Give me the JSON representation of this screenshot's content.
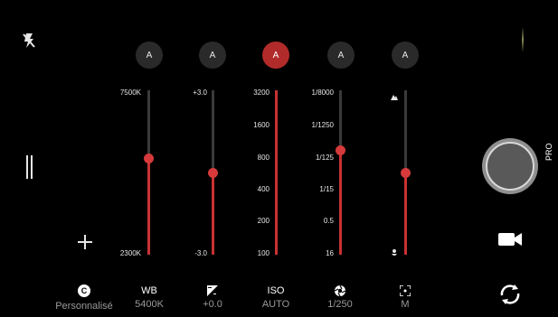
{
  "top_auto": [
    {
      "label": "A",
      "active": false
    },
    {
      "label": "A",
      "active": false
    },
    {
      "label": "A",
      "active": true
    },
    {
      "label": "A",
      "active": false
    },
    {
      "label": "A",
      "active": false
    }
  ],
  "sliders": {
    "wb": {
      "top": "7500K",
      "bottom": "2300K",
      "level": 0.59
    },
    "ev": {
      "top": "+3.0",
      "bottom": "-3.0",
      "level": 0.5
    },
    "iso": {
      "ticks": [
        "3200",
        "1600",
        "800",
        "400",
        "200",
        "100"
      ],
      "level": 1.0
    },
    "shutter": {
      "ticks": [
        "1/8000",
        "1/1250",
        "1/125",
        "1/15",
        "0.5",
        "16"
      ],
      "level": 0.64
    },
    "focus": {
      "level": 0.5
    }
  },
  "bottom_bar": [
    {
      "id": "custom",
      "icon": "c",
      "title_icon": "C",
      "value": "Personnalisé"
    },
    {
      "id": "wb",
      "title": "WB",
      "value": "5400K"
    },
    {
      "id": "ev",
      "title_icon": "exposure-icon",
      "value": "+0.0"
    },
    {
      "id": "iso",
      "title": "ISO",
      "value": "AUTO"
    },
    {
      "id": "shutter",
      "title_icon": "shutter-icon",
      "value": "1/250"
    },
    {
      "id": "focus",
      "title_icon": "focus-icon",
      "value": "M"
    }
  ],
  "mode_label": "PRO",
  "colors": {
    "accent": "#c83232",
    "bg": "#000000"
  }
}
